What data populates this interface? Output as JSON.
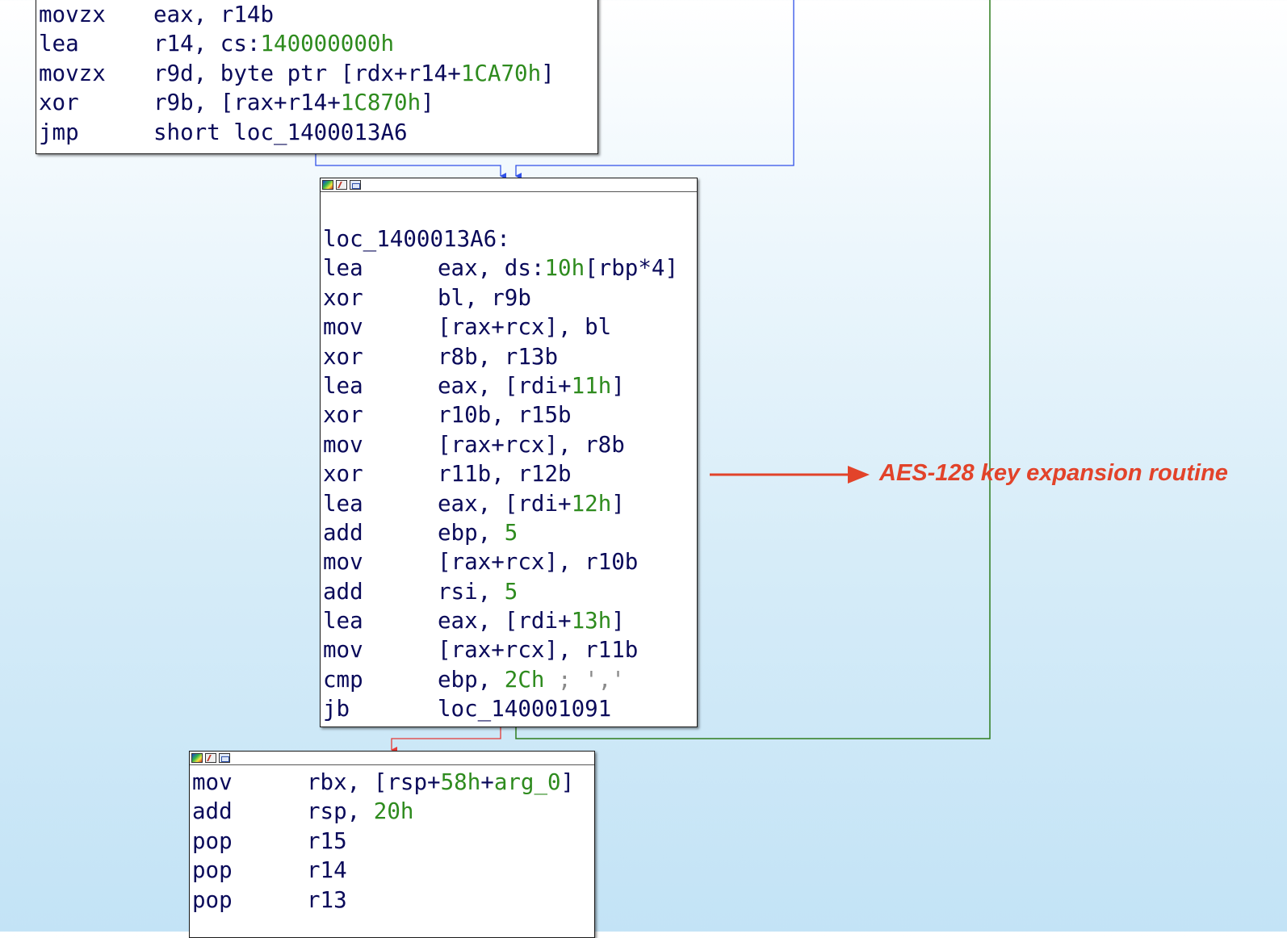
{
  "colors": {
    "edge_unconditional": "#3050e8",
    "edge_true": "#2e7d1e",
    "edge_false": "#e53935",
    "annotation": "#e2432a",
    "immediate": "#2e8b1e",
    "text": "#0a0a5a"
  },
  "header_icons": [
    "color-palette-icon",
    "edit-icon",
    "graph-icon"
  ],
  "blocks": {
    "top": {
      "lines": [
        {
          "mnemonic": "movzx",
          "parts": [
            {
              "t": "eax, r14b"
            }
          ]
        },
        {
          "mnemonic": "lea",
          "parts": [
            {
              "t": "r14, cs:"
            },
            {
              "t": "140000000h",
              "c": "num"
            }
          ]
        },
        {
          "mnemonic": "movzx",
          "parts": [
            {
              "t": "r9d, byte ptr [rdx+r14+"
            },
            {
              "t": "1CA70h",
              "c": "num"
            },
            {
              "t": "]"
            }
          ]
        },
        {
          "mnemonic": "xor",
          "parts": [
            {
              "t": "r9b, [rax+r14+"
            },
            {
              "t": "1C870h",
              "c": "num"
            },
            {
              "t": "]"
            }
          ]
        },
        {
          "mnemonic": "jmp",
          "parts": [
            {
              "t": "short loc_1400013A6"
            }
          ]
        }
      ]
    },
    "middle": {
      "label": "loc_1400013A6:",
      "lines": [
        {
          "mnemonic": "lea",
          "parts": [
            {
              "t": "eax, ds:"
            },
            {
              "t": "10h",
              "c": "num"
            },
            {
              "t": "[rbp*4]"
            }
          ]
        },
        {
          "mnemonic": "xor",
          "parts": [
            {
              "t": "bl, r9b"
            }
          ]
        },
        {
          "mnemonic": "mov",
          "parts": [
            {
              "t": "[rax+rcx], bl"
            }
          ]
        },
        {
          "mnemonic": "xor",
          "parts": [
            {
              "t": "r8b, r13b"
            }
          ]
        },
        {
          "mnemonic": "lea",
          "parts": [
            {
              "t": "eax, [rdi+"
            },
            {
              "t": "11h",
              "c": "num"
            },
            {
              "t": "]"
            }
          ]
        },
        {
          "mnemonic": "xor",
          "parts": [
            {
              "t": "r10b, r15b"
            }
          ]
        },
        {
          "mnemonic": "mov",
          "parts": [
            {
              "t": "[rax+rcx], r8b"
            }
          ]
        },
        {
          "mnemonic": "xor",
          "parts": [
            {
              "t": "r11b, r12b"
            }
          ]
        },
        {
          "mnemonic": "lea",
          "parts": [
            {
              "t": "eax, [rdi+"
            },
            {
              "t": "12h",
              "c": "num"
            },
            {
              "t": "]"
            }
          ]
        },
        {
          "mnemonic": "add",
          "parts": [
            {
              "t": "ebp, "
            },
            {
              "t": "5",
              "c": "num"
            }
          ]
        },
        {
          "mnemonic": "mov",
          "parts": [
            {
              "t": "[rax+rcx], r10b"
            }
          ]
        },
        {
          "mnemonic": "add",
          "parts": [
            {
              "t": "rsi, "
            },
            {
              "t": "5",
              "c": "num"
            }
          ]
        },
        {
          "mnemonic": "lea",
          "parts": [
            {
              "t": "eax, [rdi+"
            },
            {
              "t": "13h",
              "c": "num"
            },
            {
              "t": "]"
            }
          ]
        },
        {
          "mnemonic": "mov",
          "parts": [
            {
              "t": "[rax+rcx], r11b"
            }
          ]
        },
        {
          "mnemonic": "cmp",
          "parts": [
            {
              "t": "ebp, "
            },
            {
              "t": "2Ch",
              "c": "num"
            },
            {
              "t": " ; ','",
              "c": "cmt"
            }
          ]
        },
        {
          "mnemonic": "jb",
          "parts": [
            {
              "t": "loc_140001091"
            }
          ]
        }
      ]
    },
    "bottom": {
      "lines": [
        {
          "mnemonic": "mov",
          "parts": [
            {
              "t": "rbx, [rsp+"
            },
            {
              "t": "58h",
              "c": "num"
            },
            {
              "t": "+"
            },
            {
              "t": "arg_0",
              "c": "num"
            },
            {
              "t": "]"
            }
          ]
        },
        {
          "mnemonic": "add",
          "parts": [
            {
              "t": "rsp, "
            },
            {
              "t": "20h",
              "c": "num"
            }
          ]
        },
        {
          "mnemonic": "pop",
          "parts": [
            {
              "t": "r15"
            }
          ]
        },
        {
          "mnemonic": "pop",
          "parts": [
            {
              "t": "r14"
            }
          ]
        },
        {
          "mnemonic": "pop",
          "parts": [
            {
              "t": "r13"
            }
          ]
        }
      ]
    }
  },
  "annotation": {
    "text": "AES-128 key expansion routine"
  }
}
